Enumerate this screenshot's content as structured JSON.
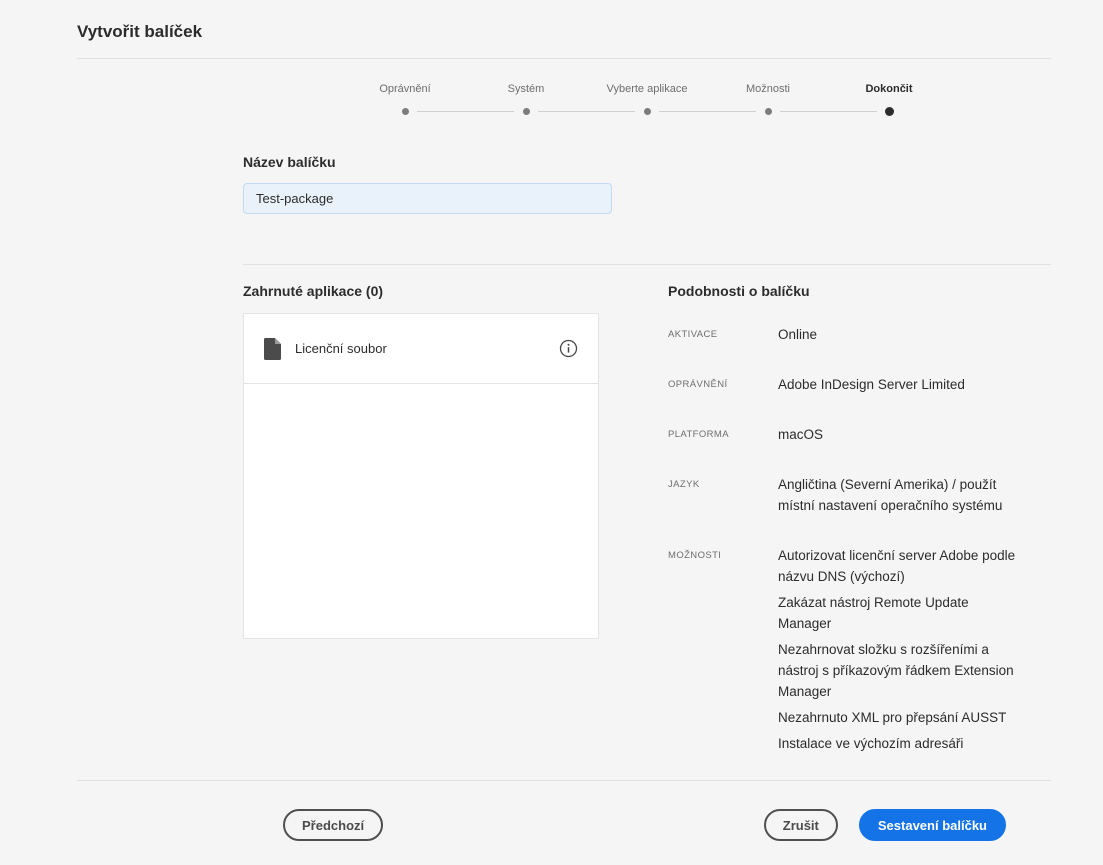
{
  "page": {
    "title": "Vytvořit balíček"
  },
  "stepper": {
    "steps": [
      {
        "label": "Oprávnění",
        "state": "done"
      },
      {
        "label": "Systém",
        "state": "done"
      },
      {
        "label": "Vyberte aplikace",
        "state": "done"
      },
      {
        "label": "Možnosti",
        "state": "done"
      },
      {
        "label": "Dokončit",
        "state": "current"
      }
    ]
  },
  "package_name": {
    "label": "Název balíčku",
    "value": "Test-package"
  },
  "included_apps": {
    "heading": "Zahrnuté aplikace (0)",
    "items": [
      {
        "label": "Licenční soubor",
        "icon": "document-file-icon"
      }
    ]
  },
  "details": {
    "heading": "Podobnosti o balíčku",
    "rows": [
      {
        "label": "AKTIVACE",
        "values": [
          "Online"
        ]
      },
      {
        "label": "OPRÁVNĚNÍ",
        "values": [
          "Adobe InDesign Server Limited"
        ]
      },
      {
        "label": "PLATFORMA",
        "values": [
          "macOS"
        ]
      },
      {
        "label": "JAZYK",
        "values": [
          "Angličtina (Severní Amerika) / použít místní nastavení operačního systému"
        ]
      },
      {
        "label": "MOŽNOSTI",
        "values": [
          "Autorizovat licenční server Adobe podle názvu DNS (výchozí)",
          "Zakázat nástroj Remote Update Manager",
          "Nezahrnovat složku s rozšířeními a nástroj s příkazovým řádkem Extension Manager",
          "Nezahrnuto XML pro přepsání AUSST",
          "Instalace ve výchozím adresáři"
        ]
      }
    ]
  },
  "footer": {
    "previous": "Předchozí",
    "cancel": "Zrušit",
    "build": "Sestavení balíčku"
  },
  "icons": {
    "app_item": "document-file-icon",
    "info": "info-circle-icon"
  },
  "colors": {
    "accent": "#1473e6",
    "page_background": "#f5f5f5",
    "input_background": "#e9f2fb",
    "divider": "#e1e1e1"
  }
}
